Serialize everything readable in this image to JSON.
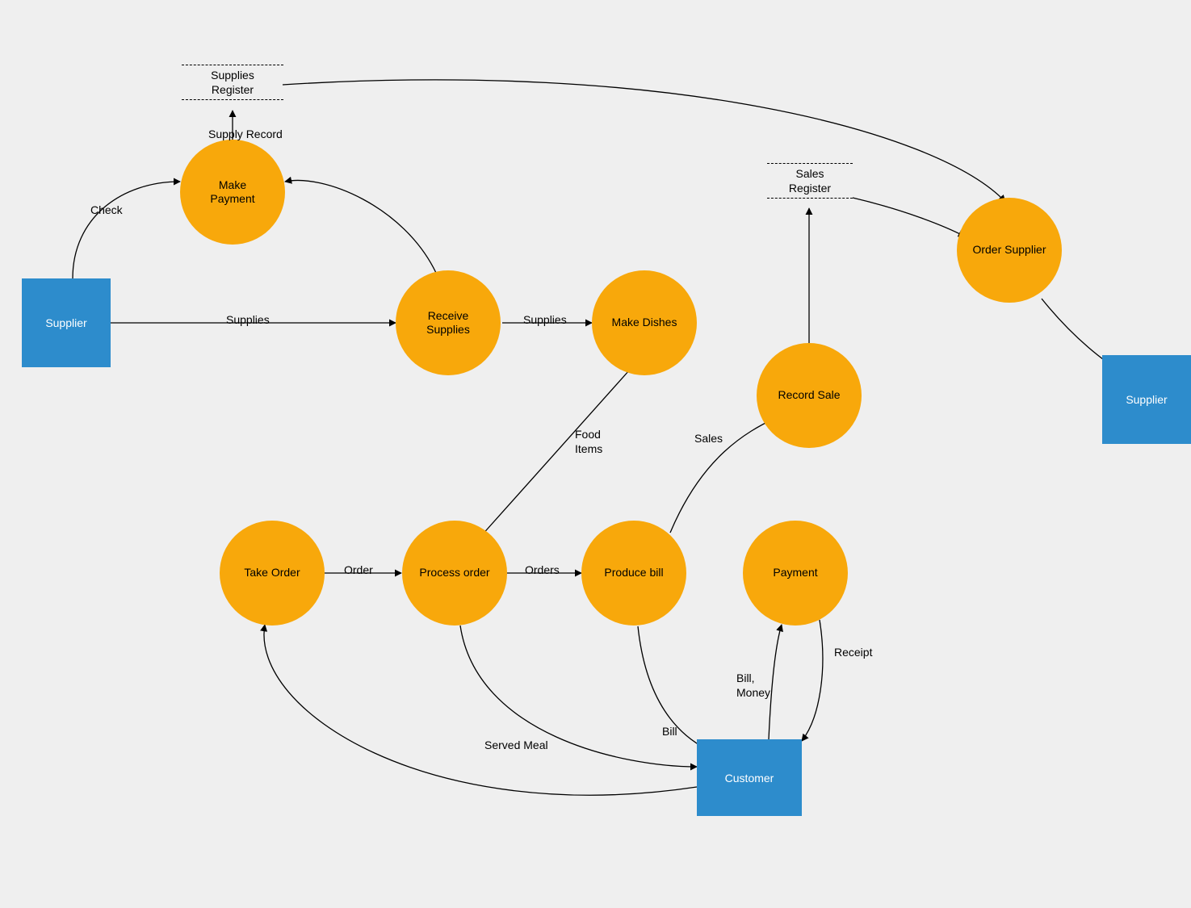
{
  "processes": {
    "make_payment": "Make\nPayment",
    "receive_supplies": "Receive\nSupplies",
    "make_dishes": "Make Dishes",
    "record_sale": "Record Sale",
    "order_supplier": "Order Supplier",
    "take_order": "Take Order",
    "process_order": "Process order",
    "produce_bill": "Produce bill",
    "payment": "Payment"
  },
  "entities": {
    "supplier_left": "Supplier",
    "supplier_right": "Supplier",
    "customer": "Customer"
  },
  "stores": {
    "supplies_register": "Supplies\nRegister",
    "sales_register": "Sales\nRegister"
  },
  "edges": {
    "check": "Check",
    "supplies": "Supplies",
    "supply_record": "Supply Record",
    "supplies2": "Supplies",
    "food_items": "Food\nItems",
    "order": "Order",
    "orders": "Orders",
    "served_meal": "Served Meal",
    "bill": "Bill",
    "bill_money": "Bill,\nMoney",
    "receipt": "Receipt",
    "sales": "Sales"
  },
  "chart_data": {
    "type": "diagram",
    "description": "Level-1 Data Flow Diagram for a restaurant ordering/supply system (Yourdon / circle-process notation).",
    "external_entities": [
      {
        "id": "supplier_left",
        "label": "Supplier"
      },
      {
        "id": "supplier_right",
        "label": "Supplier"
      },
      {
        "id": "customer",
        "label": "Customer"
      }
    ],
    "processes": [
      {
        "id": "make_payment",
        "label": "Make Payment"
      },
      {
        "id": "receive_supplies",
        "label": "Receive Supplies"
      },
      {
        "id": "make_dishes",
        "label": "Make Dishes"
      },
      {
        "id": "record_sale",
        "label": "Record Sale"
      },
      {
        "id": "order_supplier",
        "label": "Order Supplier"
      },
      {
        "id": "take_order",
        "label": "Take Order"
      },
      {
        "id": "process_order",
        "label": "Process order"
      },
      {
        "id": "produce_bill",
        "label": "Produce bill"
      },
      {
        "id": "payment",
        "label": "Payment"
      }
    ],
    "data_stores": [
      {
        "id": "supplies_register",
        "label": "Supplies Register"
      },
      {
        "id": "sales_register",
        "label": "Sales Register"
      }
    ],
    "flows": [
      {
        "from": "supplier_left",
        "to": "make_payment",
        "label": "Check"
      },
      {
        "from": "supplier_left",
        "to": "receive_supplies",
        "label": "Supplies"
      },
      {
        "from": "receive_supplies",
        "to": "make_payment",
        "label": ""
      },
      {
        "from": "make_payment",
        "to": "supplies_register",
        "label": "Supply Record"
      },
      {
        "from": "receive_supplies",
        "to": "make_dishes",
        "label": "Supplies"
      },
      {
        "from": "make_dishes",
        "to": "process_order",
        "label": "Food Items"
      },
      {
        "from": "customer",
        "to": "take_order",
        "label": ""
      },
      {
        "from": "take_order",
        "to": "process_order",
        "label": "Order"
      },
      {
        "from": "process_order",
        "to": "produce_bill",
        "label": "Orders"
      },
      {
        "from": "process_order",
        "to": "customer",
        "label": "Served Meal"
      },
      {
        "from": "produce_bill",
        "to": "customer",
        "label": "Bill"
      },
      {
        "from": "produce_bill",
        "to": "record_sale",
        "label": "Sales"
      },
      {
        "from": "customer",
        "to": "payment",
        "label": "Bill, Money"
      },
      {
        "from": "payment",
        "to": "customer",
        "label": "Receipt"
      },
      {
        "from": "record_sale",
        "to": "sales_register",
        "label": ""
      },
      {
        "from": "sales_register",
        "to": "order_supplier",
        "label": ""
      },
      {
        "from": "supplies_register",
        "to": "order_supplier",
        "label": ""
      },
      {
        "from": "order_supplier",
        "to": "supplier_right",
        "label": ""
      }
    ]
  }
}
